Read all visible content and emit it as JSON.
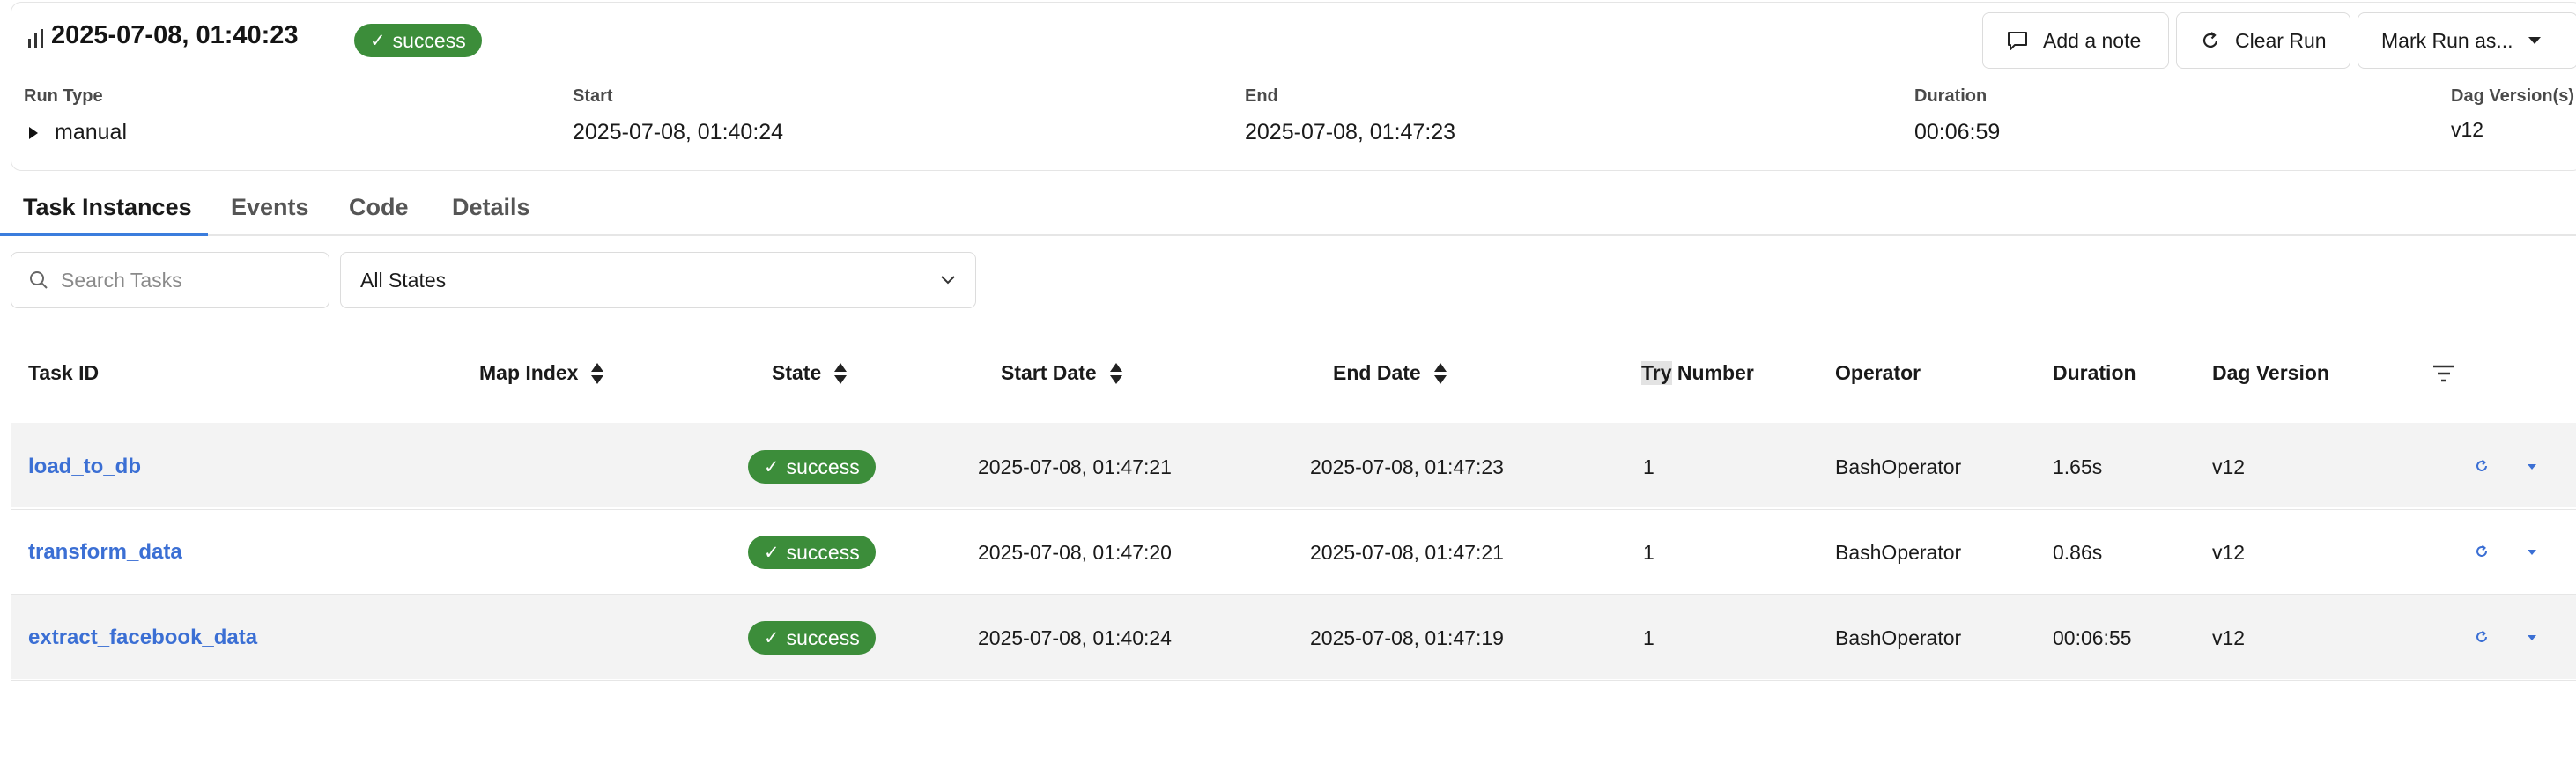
{
  "run": {
    "title": "2025-07-08, 01:40:23",
    "status": "success",
    "status_color": "#3c8d3a",
    "icon": "bar-chart-icon"
  },
  "actions": {
    "add_note": "Add a note",
    "clear_run": "Clear Run",
    "mark_run": "Mark Run as..."
  },
  "meta": {
    "run_type_label": "Run Type",
    "run_type_value": "manual",
    "start_label": "Start",
    "start_value": "2025-07-08, 01:40:24",
    "end_label": "End",
    "end_value": "2025-07-08, 01:47:23",
    "duration_label": "Duration",
    "duration_value": "00:06:59",
    "dag_version_label": "Dag Version(s)",
    "dag_version_value": "v12"
  },
  "tabs": [
    {
      "label": "Task Instances",
      "active": true
    },
    {
      "label": "Events",
      "active": false
    },
    {
      "label": "Code",
      "active": false
    },
    {
      "label": "Details",
      "active": false
    }
  ],
  "filters": {
    "search_placeholder": "Search Tasks",
    "state_selected": "All States"
  },
  "table": {
    "headers": {
      "task_id": "Task ID",
      "map_index": "Map Index",
      "state": "State",
      "start_date": "Start Date",
      "end_date": "End Date",
      "try_number_a": "Try",
      "try_number_b": " Number",
      "operator": "Operator",
      "duration": "Duration",
      "dag_version": "Dag Version"
    },
    "rows": [
      {
        "task_id": "load_to_db",
        "state": "success",
        "start": "2025-07-08, 01:47:21",
        "end": "2025-07-08, 01:47:23",
        "try": "1",
        "operator": "BashOperator",
        "duration": "1.65s",
        "dag_version": "v12"
      },
      {
        "task_id": "transform_data",
        "state": "success",
        "start": "2025-07-08, 01:47:20",
        "end": "2025-07-08, 01:47:21",
        "try": "1",
        "operator": "BashOperator",
        "duration": "0.86s",
        "dag_version": "v12"
      },
      {
        "task_id": "extract_facebook_data",
        "state": "success",
        "start": "2025-07-08, 01:40:24",
        "end": "2025-07-08, 01:47:19",
        "try": "1",
        "operator": "BashOperator",
        "duration": "00:06:55",
        "dag_version": "v12"
      }
    ]
  }
}
